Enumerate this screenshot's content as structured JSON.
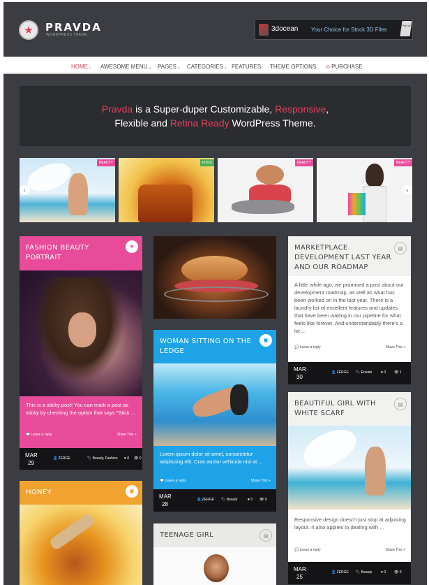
{
  "colors": {
    "accent": "#e0405a",
    "pink": "#e84b9a",
    "blue": "#1fa3e8",
    "orange": "#f0a32f",
    "dark": "#3b3d42"
  },
  "header": {
    "logo_icon": "star-icon",
    "logo_title": "PRAVDA",
    "logo_tagline": "WORDPRESS THEME",
    "ad": {
      "brand": "3docean",
      "text": "Your Choice for Stock 3D Files",
      "corner": "Part of"
    }
  },
  "nav": {
    "items": [
      {
        "label": "HOME",
        "active": true,
        "dropdown": true
      },
      {
        "label": "AWESOME MENU",
        "dropdown": true
      },
      {
        "label": "PAGES",
        "dropdown": true
      },
      {
        "label": "CATEGORIES",
        "dropdown": true
      },
      {
        "label": "FEATURES"
      },
      {
        "label": "THEME OPTIONS"
      },
      {
        "label": "PURCHASE",
        "icon": "cart-icon"
      }
    ]
  },
  "hero": {
    "brand": "Pravda",
    "l1a": " is a Super-duper Customizable, ",
    "l1b": "Responsive",
    ",": ",",
    "l2a": "Flexible and ",
    "l2b": "Retina Ready",
    "l2c": " WordPress Theme."
  },
  "slider": {
    "tags": [
      "BEAUTY",
      "FOOD",
      "BEAUTY",
      "BEAUTY"
    ],
    "prev_icon": "chevron-left-icon",
    "next_icon": "chevron-right-icon"
  },
  "posts": {
    "fashion": {
      "title": "FASHION BEAUTY PORTRAIT",
      "excerpt": "This is a sticky post! You can mark a post as sticky by checking the option that says \"Stick ...",
      "reply": "Leave a reply",
      "share": "Share This",
      "month": "MAR",
      "day": "29",
      "author": "ZERGE",
      "cats": "Beauty, Fashion",
      "likes": "0",
      "views": "0"
    },
    "honey": {
      "title": "HONEY"
    },
    "woman": {
      "title": "WOMAN SITTING ON THE LEDGE",
      "excerpt": "Lorem ipsum dolor sit amet, consectetur adipiscing elit. Cras auctor vehicula nisl at ...",
      "reply": "Leave a reply",
      "share": "Share This",
      "month": "MAR",
      "day": "28",
      "author": "ZERGE",
      "cats": "Beauty",
      "likes": "0",
      "views": "0"
    },
    "teenage": {
      "title": "TEENAGE GIRL"
    },
    "market": {
      "title": "MARKETPLACE DEVELOPMENT LAST YEAR AND OUR ROADMAP",
      "excerpt": "A little while ago, we promised a post about our development roadmap, as well as what has been worked on in the last year. There is a laundry list of excellent features and updates that have been waiting in our pipeline for what feels like forever. And understandably there's a lot ...",
      "reply": "Leave a reply",
      "share": "Share This",
      "month": "MAR",
      "day": "30",
      "author": "ZERGE",
      "cats": "Envato",
      "likes": "0",
      "views": "1"
    },
    "scarf": {
      "title": "BEAUTIFUL GIRL WITH WHITE SCARF",
      "excerpt": "Responsive design doesn't just stop at adjusting layout. It also applies to dealing with ...",
      "reply": "Leave a reply",
      "share": "Share This",
      "month": "MAR",
      "day": "25",
      "author": "ZERGE",
      "cats": "Beauty",
      "likes": "0",
      "views": "0"
    }
  }
}
